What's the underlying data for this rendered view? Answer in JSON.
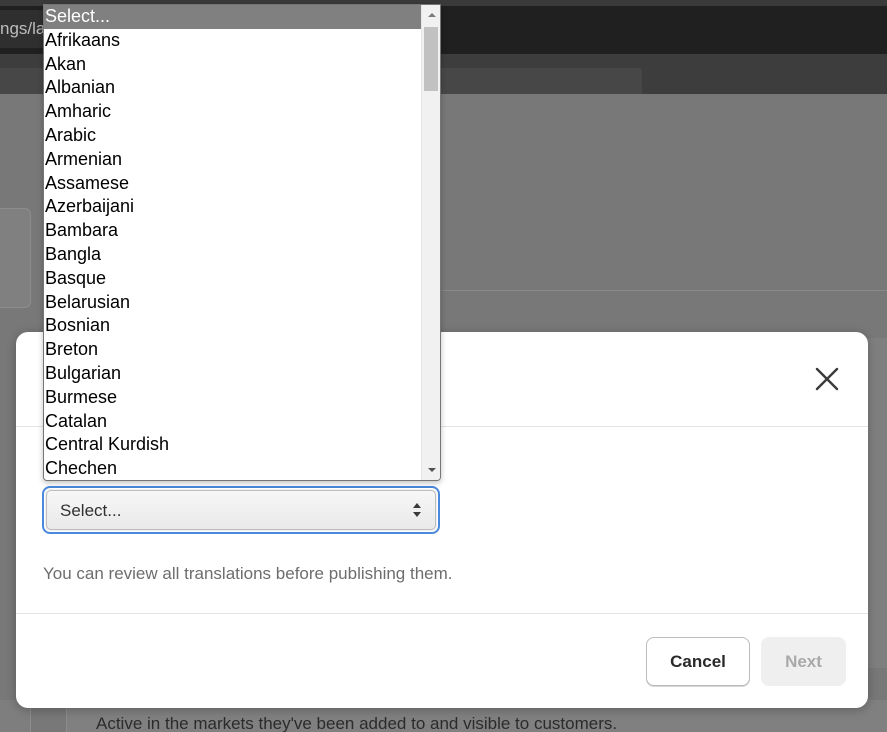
{
  "background": {
    "url_fragment": "ngs/la",
    "page_text": "Active in the markets they've been added to and visible to customers."
  },
  "modal": {
    "close_icon": "close-icon",
    "select": {
      "value": "Select..."
    },
    "helper_text": "You can review all translations before publishing them.",
    "cancel_label": "Cancel",
    "next_label": "Next"
  },
  "dropdown": {
    "options": [
      "Select...",
      "Afrikaans",
      "Akan",
      "Albanian",
      "Amharic",
      "Arabic",
      "Armenian",
      "Assamese",
      "Azerbaijani",
      "Bambara",
      "Bangla",
      "Basque",
      "Belarusian",
      "Bosnian",
      "Breton",
      "Bulgarian",
      "Burmese",
      "Catalan",
      "Central Kurdish",
      "Chechen"
    ],
    "selected_index": 0
  },
  "colors": {
    "focus_border": "#4a89dc",
    "selected_option_bg": "#808080",
    "overlay_bg": "#787878"
  }
}
